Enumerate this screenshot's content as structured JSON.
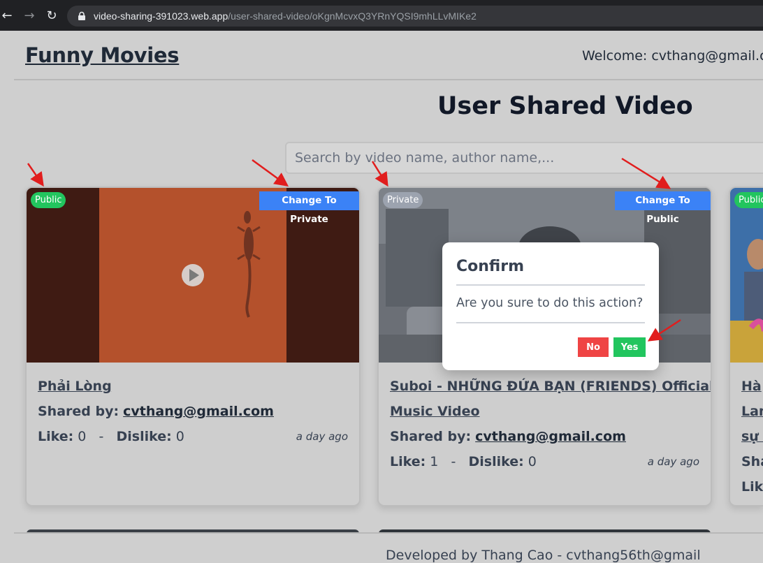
{
  "browser": {
    "url_host": "video-sharing-391023.web.app",
    "url_path": "/user-shared-video/oKgnMcvxQ3YRnYQSI9mhLLvMIKe2"
  },
  "header": {
    "brand": "Funny Movies",
    "welcome": "Welcome: cvthang@gmail.com"
  },
  "main": {
    "title": "User Shared Video",
    "search_placeholder": "Search by video name, author name,..."
  },
  "cards": [
    {
      "status": "Public",
      "toggle_label": "Change To Private",
      "title": "Phải Lòng",
      "shared_by_label": "Shared by:",
      "shared_by": "cvthang@gmail.com",
      "like_label": "Like:",
      "likes": "0",
      "separator": "-",
      "dislike_label": "Dislike:",
      "dislikes": "0",
      "time_ago": "a day ago"
    },
    {
      "status": "Private",
      "toggle_label": "Change To Public",
      "title_line1": "Suboi - NHỮNG ĐỨA BẠN (FRIENDS) Official",
      "title_line2": "Music Video",
      "shared_by_label": "Shared by:",
      "shared_by": "cvthang@gmail.com",
      "like_label": "Like:",
      "likes": "1",
      "separator": "-",
      "dislike_label": "Dislike:",
      "dislikes": "0",
      "time_ago": "a day ago"
    },
    {
      "status": "Public",
      "title_line1": "Hà",
      "title_line2": "Lan",
      "title_line3": "sự c",
      "shared_by_fragment": "Sha",
      "like_fragment": "Like"
    }
  ],
  "modal": {
    "title": "Confirm",
    "message": "Are you sure to do this action?",
    "no_label": "No",
    "yes_label": "Yes"
  },
  "footer": {
    "text": "Developed by Thang Cao - cvthang56th@gmail"
  },
  "colors": {
    "public_badge": "#22c55e",
    "private_badge": "#9ca3af",
    "toggle_button": "#3b82f6",
    "no_button": "#ef4444",
    "yes_button": "#22c55e",
    "annotation_arrow": "#e11d1d"
  }
}
